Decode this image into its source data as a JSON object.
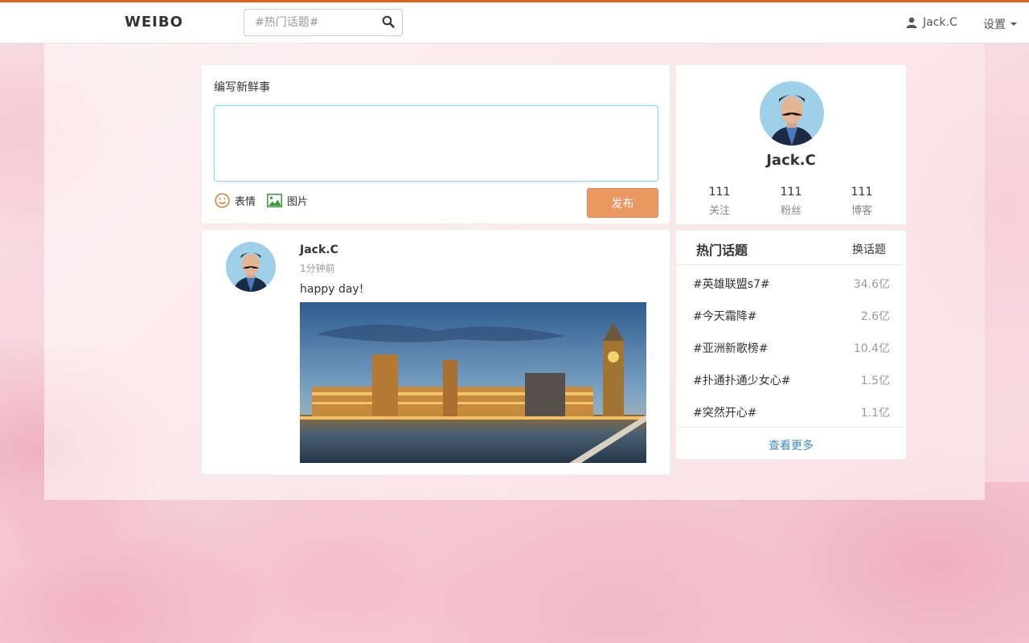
{
  "navbar": {
    "brand": "WEIBO",
    "search_placeholder": "#热门话题#",
    "user_name": "Jack.C",
    "settings_label": "设置"
  },
  "compose": {
    "title": "编写新鲜事",
    "emoji_label": "表情",
    "image_label": "图片",
    "publish_label": "发布"
  },
  "post": {
    "author": "Jack.C",
    "time": "1分钟前",
    "text": "happy day!"
  },
  "profile": {
    "name": "Jack.C",
    "stats": [
      {
        "value": "111",
        "label": "关注"
      },
      {
        "value": "111",
        "label": "粉丝"
      },
      {
        "value": "111",
        "label": "博客"
      }
    ]
  },
  "hot_topics": {
    "title": "热门话题",
    "change_label": "换话题",
    "items": [
      {
        "name": "#英雄联盟s7#",
        "count": "34.6亿"
      },
      {
        "name": "#今天霜降#",
        "count": "2.6亿"
      },
      {
        "name": "#亚洲新歌榜#",
        "count": "10.4亿"
      },
      {
        "name": "#扑通扑通少女心#",
        "count": "1.5亿"
      },
      {
        "name": "#突然开心#",
        "count": "1.1亿"
      }
    ],
    "more_label": "查看更多"
  },
  "colors": {
    "accent": "#e3611a",
    "publish_button": "#eb9862",
    "link": "#428bca"
  },
  "icons": [
    "search-icon",
    "user-icon",
    "caret-down-icon",
    "smile-icon",
    "image-icon"
  ]
}
